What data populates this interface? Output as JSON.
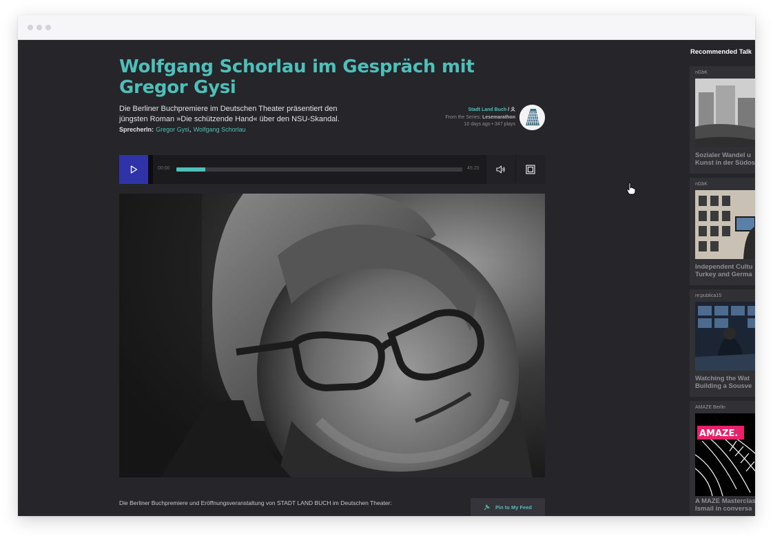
{
  "talk": {
    "title": "Wolfgang Schorlau im Gespräch mit Gregor Gysi",
    "summary": "Die Berliner Buchpremiere im Deutschen Theater präsentiert den jüngsten Roman »Die schützende Hand« über den NSU-Skandal.",
    "speakers_label": "SprecherIn:",
    "speakers": [
      "Gregor Gysi",
      "Wolfgang Schorlau"
    ],
    "speaker_separator": ", "
  },
  "meta": {
    "organizer": "Stadt Land Buch",
    "separator": "/",
    "series_prefix": "From the Series:",
    "series": "Lesemarathon",
    "age": "10 days ago",
    "plays": "347 plays",
    "dot": "•"
  },
  "player": {
    "current_time": "00:00",
    "duration": "45:20",
    "progress": 0.1
  },
  "description": "Die Berliner Buchpremiere und Eröffnungsveranstaltung von STADT LAND BUCH im Deutschen Theater:",
  "pin_button": {
    "label": "Pin to My Feed"
  },
  "recommended": {
    "heading": "Recommended Talk",
    "cards": [
      {
        "source": "nGbK",
        "title_line1": "Sozialer Wandel u",
        "title_line2": "Kunst in der Südos"
      },
      {
        "source": "nGbK",
        "title_line1": "Independent Cultu",
        "title_line2": "Turkey and Germa"
      },
      {
        "source": "re:publica15",
        "title_line1": "Watching the Wat",
        "title_line2": "Building a Sousve"
      },
      {
        "source": "AMAZE Berlin",
        "title_line1": "A MAZE Masterclas",
        "title_line2": "Ismail in conversa",
        "logo_text": "AMAZE."
      }
    ]
  },
  "colors": {
    "accent": "#4fc0b9",
    "play_button": "#3033a8",
    "background": "#25252a"
  },
  "icons": {
    "play": "play-icon",
    "volume": "volume-icon",
    "expand": "expand-icon",
    "pin": "pin-icon",
    "user": "user-icon"
  }
}
